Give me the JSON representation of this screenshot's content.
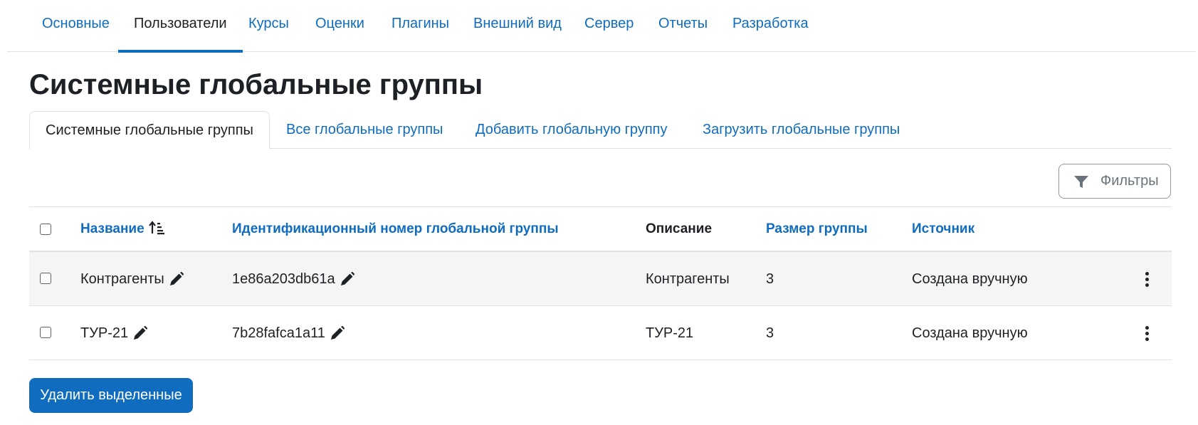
{
  "topnav": {
    "items": [
      "Основные",
      "Пользователи",
      "Курсы",
      "Оценки",
      "Плагины",
      "Внешний вид",
      "Сервер",
      "Отчеты",
      "Разработка"
    ],
    "active": "Пользователи"
  },
  "page_title": "Системные глобальные группы",
  "subtabs": {
    "items": [
      "Системные глобальные группы",
      "Все глобальные группы",
      "Добавить глобальную группу",
      "Загрузить глобальные группы"
    ],
    "active": "Системные глобальные группы"
  },
  "filters_label": "Фильтры",
  "table": {
    "headers": {
      "name": "Название",
      "idnumber": "Идентификационный номер глобальной группы",
      "description": "Описание",
      "size": "Размер группы",
      "source": "Источник"
    },
    "rows": [
      {
        "name": "Контрагенты",
        "idnumber": "1e86a203db61a",
        "description": "Контрагенты",
        "size": "3",
        "source": "Создана вручную"
      },
      {
        "name": "ТУР-21",
        "idnumber": "7b28fafca1a11",
        "description": "ТУР-21",
        "size": "3",
        "source": "Создана вручную"
      }
    ]
  },
  "delete_selected_label": "Удалить выделенные",
  "colors": {
    "link": "#0f6cbf",
    "text": "#1d2125",
    "border": "#dee2e6",
    "stripe": "#f5f5f5",
    "primary_button": "#0f6cbf"
  },
  "icons": [
    "filter-icon",
    "sort-ascending-icon",
    "pencil-icon",
    "kebab-menu-icon"
  ]
}
